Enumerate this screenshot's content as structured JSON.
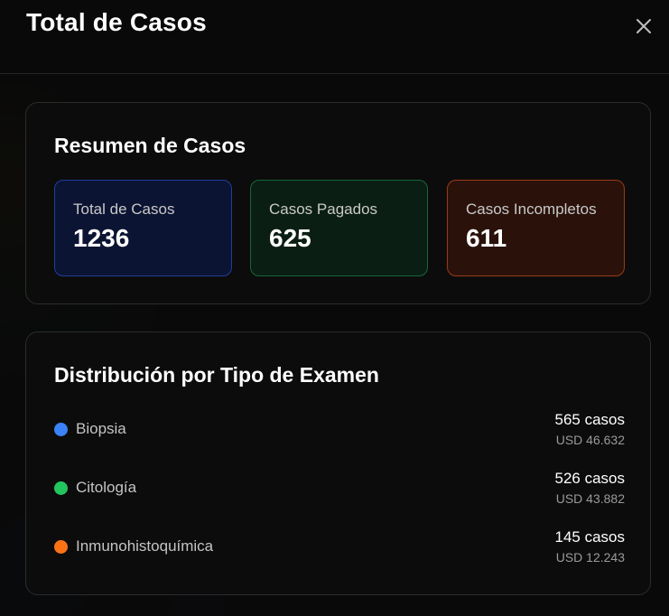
{
  "modal": {
    "title": "Total de Casos",
    "close_icon": "close-icon"
  },
  "summary": {
    "title": "Resumen de Casos",
    "stats": [
      {
        "label": "Total de Casos",
        "value": "1236",
        "accent": "#1f3f9a"
      },
      {
        "label": "Casos Pagados",
        "value": "625",
        "accent": "#17653a"
      },
      {
        "label": "Casos Incompletos",
        "value": "611",
        "accent": "#9a3a17"
      }
    ]
  },
  "distribution": {
    "title": "Distribución por Tipo de Examen",
    "items": [
      {
        "name": "Biopsia",
        "count": "565 casos",
        "amount": "USD 46.632",
        "color": "#3b82f6"
      },
      {
        "name": "Citología",
        "count": "526 casos",
        "amount": "USD 43.882",
        "color": "#22c55e"
      },
      {
        "name": "Inmunohistoquímica",
        "count": "145 casos",
        "amount": "USD 12.243",
        "color": "#f97316"
      }
    ]
  }
}
